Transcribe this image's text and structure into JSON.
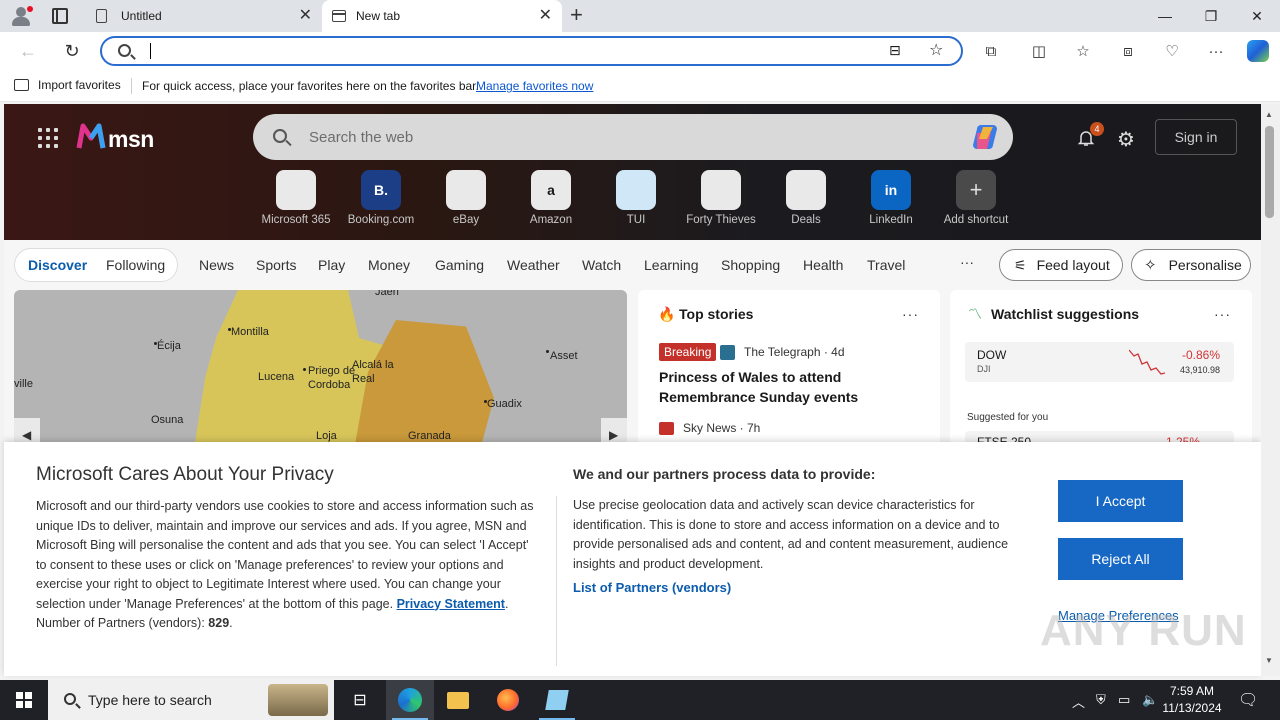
{
  "browser": {
    "tabs": [
      {
        "title": "Untitled"
      },
      {
        "title": "New tab"
      }
    ],
    "address": {
      "value": "",
      "placeholder": ""
    }
  },
  "favorites_bar": {
    "import_label": "Import favorites",
    "message": "For quick access, place your favorites here on the favorites bar.",
    "manage_link": "Manage favorites now"
  },
  "msn": {
    "logo_text": "msn",
    "search_placeholder": "Search the web",
    "notification_count": "4",
    "sign_in": "Sign in",
    "shortcuts": [
      {
        "label": "Microsoft 365",
        "icon": "microsoft-365-icon",
        "glyph": "",
        "bg": "#e9e9e9"
      },
      {
        "label": "Booking.com",
        "icon": "booking-icon",
        "glyph": "B.",
        "bg": "#1b3e86"
      },
      {
        "label": "eBay",
        "icon": "ebay-icon",
        "glyph": "",
        "bg": "#e9e9e9"
      },
      {
        "label": "Amazon",
        "icon": "amazon-icon",
        "glyph": "a",
        "bg": "#e9e9e9"
      },
      {
        "label": "TUI",
        "icon": "tui-icon",
        "glyph": "",
        "bg": "#cfe7f7"
      },
      {
        "label": "Forty Thieves",
        "icon": "forty-thieves-icon",
        "glyph": "",
        "bg": "#e9e9e9"
      },
      {
        "label": "Deals",
        "icon": "deals-icon",
        "glyph": "",
        "bg": "#e9e9e9"
      },
      {
        "label": "LinkedIn",
        "icon": "linkedin-icon",
        "glyph": "in",
        "bg": "#0a66c2"
      },
      {
        "label": "Add shortcut",
        "icon": "plus-icon",
        "glyph": "+",
        "bg": "#4a4a4a"
      }
    ],
    "nav": {
      "discover": "Discover",
      "following": "Following",
      "links": [
        "News",
        "Sports",
        "Play",
        "Money",
        "Gaming",
        "Weather",
        "Watch",
        "Learning",
        "Shopping",
        "Health",
        "Travel"
      ],
      "more": "···",
      "feed_layout": "Feed layout",
      "personalise": "Personalise"
    },
    "map_labels": [
      "Jaén",
      "Montilla",
      "Écija",
      "Lucena",
      "Priego de Cordoba",
      "Alcalá la Real",
      "Asset",
      "Osuna",
      "Loja",
      "Granada",
      "Guadix",
      "ville"
    ],
    "top_stories": {
      "title": "Top stories",
      "badge": "Breaking",
      "source1": "The Telegraph · 4d",
      "headline": "Princess of Wales to attend Remembrance Sunday events",
      "source2": "Sky News · 7h"
    },
    "watchlist": {
      "title": "Watchlist suggestions",
      "stock": {
        "symbol": "DOW",
        "exchange": "DJI",
        "change": "-0.86%",
        "price": "43,910.98"
      },
      "suggested": "Suggested for you",
      "next_symbol": "FTSE 250",
      "next_change": "-1.25%"
    }
  },
  "privacy": {
    "title": "Microsoft Cares About Your Privacy",
    "body": "Microsoft and our third-party vendors use cookies to store and access information such as unique IDs to deliver, maintain and improve our services and ads. If you agree, MSN and Microsoft Bing will personalise the content and ads that you see. You can select 'I Accept' to consent to these uses or click on 'Manage preferences' to review your options and exercise your right to object to Legitimate Interest where used.  You can change your selection under 'Manage Preferences' at the bottom of this page.",
    "privacy_link": "Privacy Statement",
    "partners_label": "Number of Partners (vendors):",
    "partners_count": "829",
    "right_title": "We and our partners process data to provide:",
    "right_body": "Use precise geolocation data and actively scan device characteristics for identification. This is done to store and access information on a device and to provide personalised ads and content, ad and content measurement, audience insights and product development.",
    "partners_link": "List of Partners (vendors)",
    "accept": "I Accept",
    "reject": "Reject All",
    "manage": "Manage Preferences"
  },
  "watermark": "ANY RUN",
  "taskbar": {
    "search_placeholder": "Type here to search",
    "time": "7:59 AM",
    "date": "11/13/2024"
  },
  "colors": {
    "accent": "#1768c4",
    "link": "#0b5cad",
    "breaking": "#c4312b",
    "negative": "#d13438"
  }
}
